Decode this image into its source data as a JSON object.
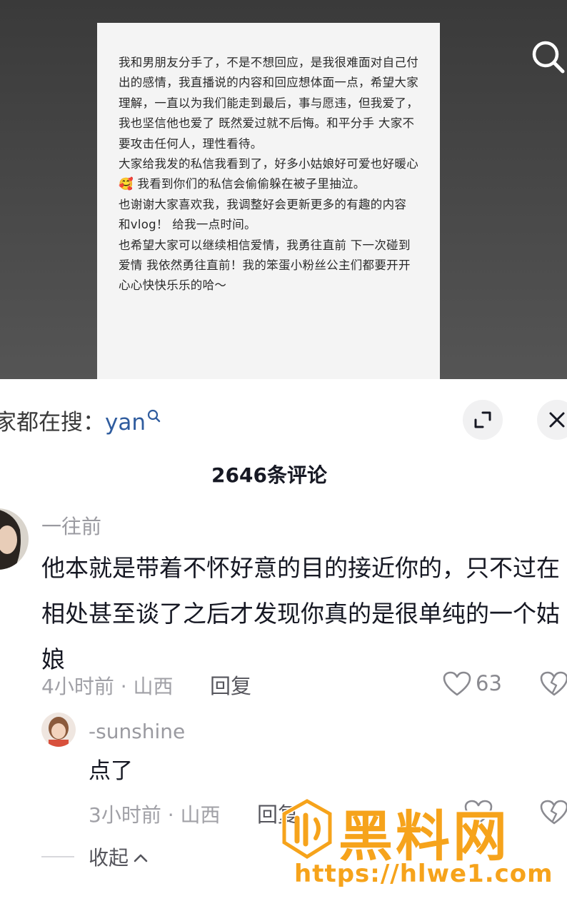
{
  "video": {
    "note_text": "我和男朋友分手了，不是不想回应，是我很难面对自己付出的感情，我直播说的内容和回应想体面一点，希望大家理解，一直以为我们能走到最后，事与愿违，但我爱了，我也坚信他也爱了 既然爱过就不后悔。和平分手 大家不要攻击任何人，理性看待。\n大家给我发的私信我看到了，好多小姑娘好可爱也好暖心 🥰 我看到你们的私信会偷偷躲在被子里抽泣。\n也谢谢大家喜欢我，我调整好会更新更多的有趣的内容 和vlog！ 给我一点时间。\n也希望大家可以继续相信爱情，我勇往直前 下一次碰到爱情 我依然勇往直前！我的笨蛋小粉丝公主们都要开开心心快快乐乐的哈～",
    "search_icon": "search-icon"
  },
  "panel": {
    "trending_prefix": "家都在搜：",
    "trending_term": "yan",
    "comment_count": "2646条评论"
  },
  "comments": [
    {
      "username": "一往前",
      "text": "他本就是带着不怀好意的目的接近你的，只不过在相处甚至谈了之后才发现你真的是很单纯的一个姑娘",
      "meta": "4小时前 · 山西",
      "reply_label": "回复",
      "likes": "63"
    },
    {
      "username": "-sunshine",
      "text": "点了",
      "meta": "3小时前 · 山西",
      "reply_label": "回复"
    }
  ],
  "collapse_label": "收起",
  "watermark": {
    "title": "黑料网",
    "url": "https://hlwe1.com"
  },
  "colors": {
    "accent_orange": "#f6a31b",
    "link_blue": "#2f5c9e"
  }
}
